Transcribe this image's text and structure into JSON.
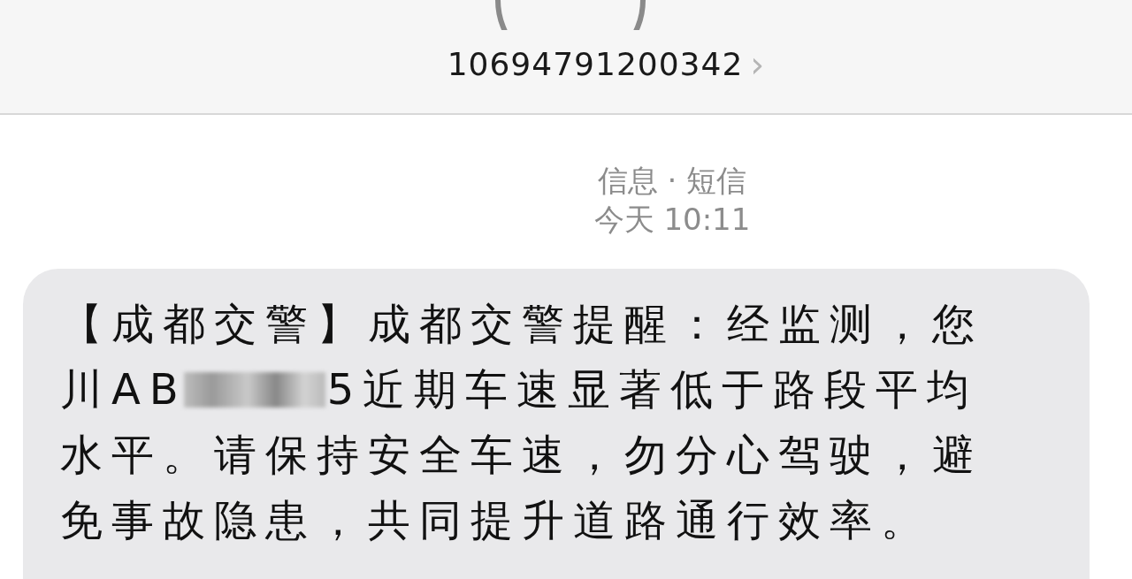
{
  "header": {
    "sender": "10694791200342",
    "chevron": "›"
  },
  "meta": {
    "service": "信息 · 短信",
    "time": "今天 10:11"
  },
  "message": {
    "lines": [
      {
        "segments": [
          {
            "kind": "text",
            "text": "【成都交警】成都交警提醒：经监测，您"
          }
        ]
      },
      {
        "segments": [
          {
            "kind": "text",
            "text": "川AB"
          },
          {
            "kind": "redacted"
          },
          {
            "kind": "text",
            "text": "5近期车速显著低于路段平均"
          }
        ]
      },
      {
        "segments": [
          {
            "kind": "text",
            "text": "水平。请保持安全车速，勿分心驾驶，避"
          }
        ]
      },
      {
        "segments": [
          {
            "kind": "text",
            "text": "免事故隐患，共同提升道路通行效率。"
          }
        ]
      }
    ]
  }
}
